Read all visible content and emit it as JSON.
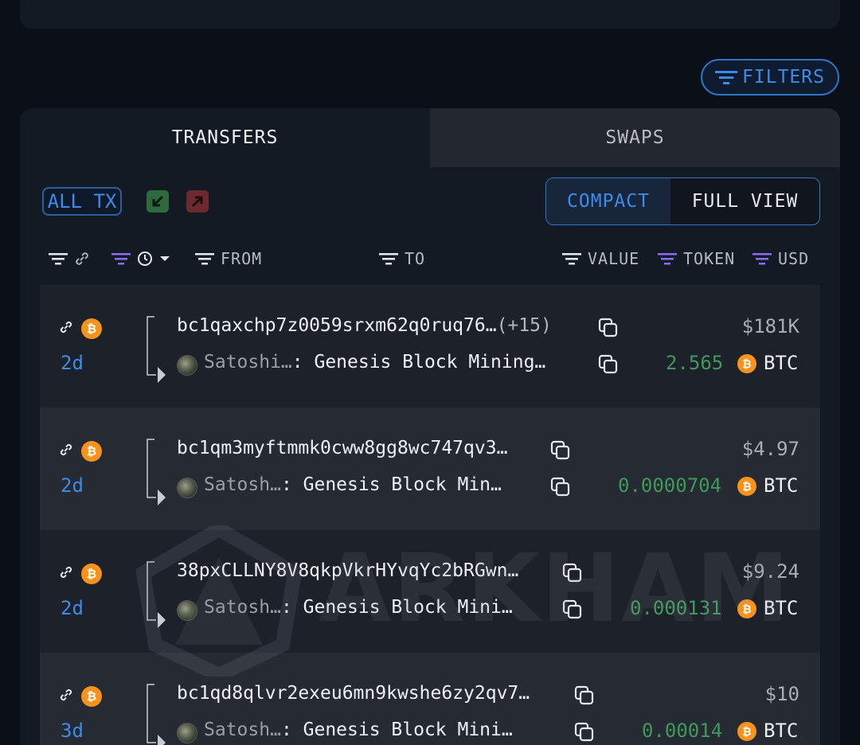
{
  "filters_button": {
    "label": "FILTERS",
    "icon": "filter-lines-icon",
    "color": "#3d8be8"
  },
  "tabs": [
    {
      "label": "TRANSFERS",
      "active": true
    },
    {
      "label": "SWAPS",
      "active": false
    }
  ],
  "toolbar": {
    "all_tx_label": "ALL TX",
    "incoming_icon": "arrow-down-left-icon",
    "outgoing_icon": "arrow-up-right-icon",
    "view_compact_label": "COMPACT",
    "view_full_label": "FULL VIEW",
    "selected_view": "COMPACT"
  },
  "columns": {
    "from": "FROM",
    "to": "TO",
    "value": "VALUE",
    "token": "TOKEN",
    "usd": "USD"
  },
  "rows": [
    {
      "time": "2d",
      "from": "bc1qaxchp7z0059srxm62q0ruq76…",
      "from_more": "(+15)",
      "to_entity": "Satoshi…",
      "to_label": ": Genesis Block Mining…",
      "usd": "$181K",
      "amount": "2.565",
      "token": "BTC"
    },
    {
      "time": "2d",
      "from": "bc1qm3myftmmk0cww8gg8wc747qv3…",
      "from_more": "",
      "to_entity": "Satosh…",
      "to_label": ": Genesis Block Min…",
      "usd": "$4.97",
      "amount": "0.0000704",
      "token": "BTC"
    },
    {
      "time": "2d",
      "from": "38pxCLLNY8V8qkpVkrHYvqYc2bRGwn…",
      "from_more": "",
      "to_entity": "Satosh…",
      "to_label": ": Genesis Block Mini…",
      "usd": "$9.24",
      "amount": "0.000131",
      "token": "BTC"
    },
    {
      "time": "3d",
      "from": "bc1qd8qlvr2exeu6mn9kwshe6zy2qv7…",
      "from_more": "",
      "to_entity": "Satosh…",
      "to_label": ": Genesis Block Mini…",
      "usd": "$10",
      "amount": "0.00014",
      "token": "BTC"
    }
  ],
  "token_symbol_glyph": "₿",
  "watermark": "ARKHAM",
  "colors": {
    "accent": "#3d8be8",
    "positive": "#3f9a5a",
    "btc": "#f7931a",
    "purple_filter": "#8b6cf0"
  }
}
